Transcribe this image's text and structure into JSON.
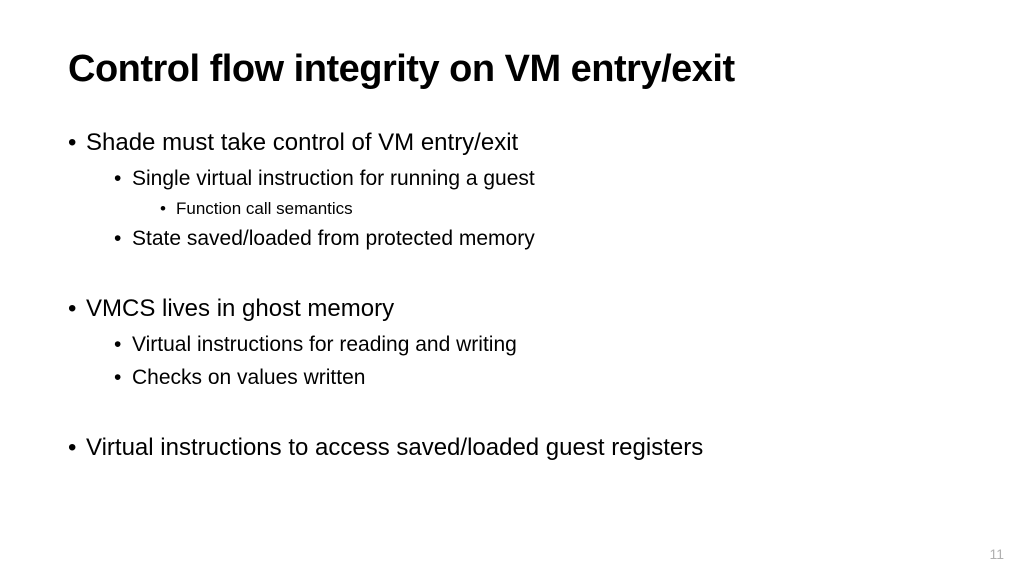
{
  "title": "Control flow integrity on VM entry/exit",
  "bullets": {
    "b1": "Shade must take control of VM entry/exit",
    "b1_1": "Single virtual instruction for running a guest",
    "b1_1_1": "Function call semantics",
    "b1_2": "State saved/loaded from protected memory",
    "b2": "VMCS lives in ghost memory",
    "b2_1": "Virtual instructions for reading and writing",
    "b2_2": "Checks on values written",
    "b3": "Virtual instructions to access saved/loaded guest registers"
  },
  "pageNumber": "11"
}
